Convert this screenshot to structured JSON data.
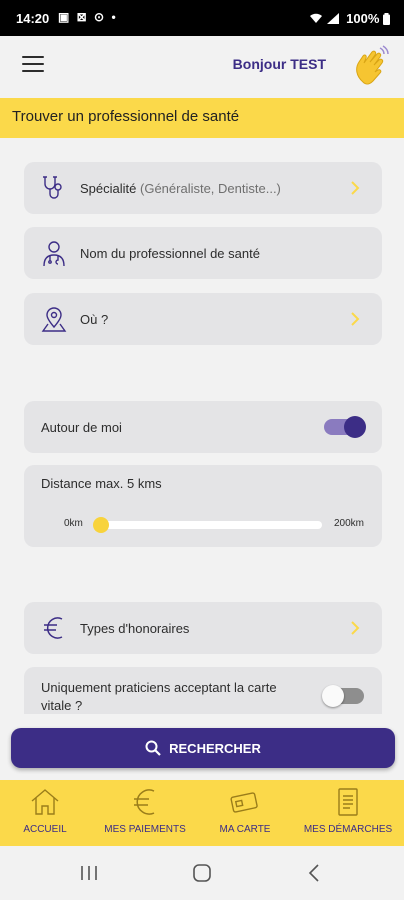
{
  "status_bar": {
    "time": "14:20",
    "icons": "▣ ⊠ ⊙ •",
    "battery": "100%"
  },
  "header": {
    "greeting": "Bonjour TEST",
    "menu_icon": "menu-icon",
    "wave_icon": "waving-hand-icon"
  },
  "banner": {
    "title": "Trouver un professionnel de santé"
  },
  "form": {
    "speciality": {
      "label": "Spécialité",
      "hint": "(Généraliste, Dentiste...)",
      "icon": "stethoscope-icon"
    },
    "professional_name": {
      "placeholder": "Nom du professionnel de santé",
      "icon": "doctor-icon"
    },
    "location": {
      "label": "Où ?",
      "icon": "map-pin-icon"
    },
    "around_me": {
      "label": "Autour de moi",
      "enabled": true
    },
    "distance": {
      "label": "Distance max. 5 kms",
      "min_label": "0km",
      "max_label": "200km",
      "value": 5,
      "min": 0,
      "max": 200
    },
    "fee_types": {
      "label": "Types d'honoraires",
      "icon": "euro-icon"
    },
    "vitale_only": {
      "label": "Uniquement praticiens acceptant la carte vitale ?",
      "enabled": false
    }
  },
  "search_button": {
    "label": "RECHERCHER"
  },
  "bottom_nav": {
    "items": [
      {
        "label": "ACCUEIL",
        "icon": "home-icon"
      },
      {
        "label": "MES PAIEMENTS",
        "icon": "euro-icon"
      },
      {
        "label": "MA CARTE",
        "icon": "card-icon"
      },
      {
        "label": "MES DÉMARCHES",
        "icon": "document-icon"
      }
    ]
  },
  "colors": {
    "primary": "#3c2d86",
    "accent": "#fbd94a",
    "card": "#e4e4e6",
    "background": "#f2f2f2"
  }
}
